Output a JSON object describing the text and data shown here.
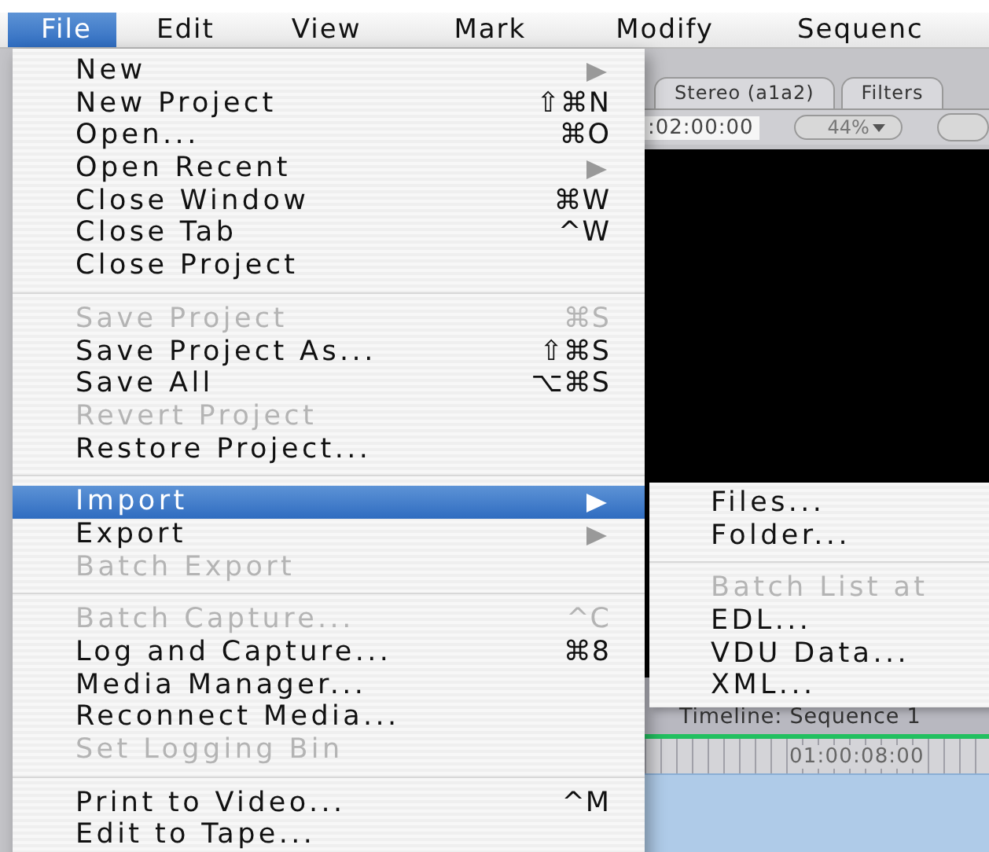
{
  "menubar": [
    {
      "label": "File",
      "selected": true
    },
    {
      "label": "Edit",
      "selected": false
    },
    {
      "label": "View",
      "selected": false
    },
    {
      "label": "Mark",
      "selected": false
    },
    {
      "label": "Modify",
      "selected": false
    },
    {
      "label": "Sequenc",
      "selected": false
    }
  ],
  "file_menu": {
    "items": [
      {
        "kind": "item",
        "label": "New",
        "submenu": true,
        "disabled": false,
        "selected": false
      },
      {
        "kind": "item",
        "label": "New Project",
        "shortcut": "⇧⌘N",
        "disabled": false,
        "selected": false
      },
      {
        "kind": "item",
        "label": "Open...",
        "shortcut": "⌘O",
        "disabled": false,
        "selected": false
      },
      {
        "kind": "item",
        "label": "Open Recent",
        "submenu": true,
        "disabled": false,
        "selected": false
      },
      {
        "kind": "item",
        "label": "Close Window",
        "shortcut": "⌘W",
        "disabled": false,
        "selected": false
      },
      {
        "kind": "item",
        "label": "Close Tab",
        "shortcut": "^W",
        "disabled": false,
        "selected": false
      },
      {
        "kind": "item",
        "label": "Close Project",
        "disabled": false,
        "selected": false
      },
      {
        "kind": "separator"
      },
      {
        "kind": "item",
        "label": "Save Project",
        "shortcut": "⌘S",
        "disabled": true,
        "selected": false
      },
      {
        "kind": "item",
        "label": "Save Project As...",
        "shortcut": "⇧⌘S",
        "disabled": false,
        "selected": false
      },
      {
        "kind": "item",
        "label": "Save All",
        "shortcut": "⌥⌘S",
        "disabled": false,
        "selected": false
      },
      {
        "kind": "item",
        "label": "Revert Project",
        "disabled": true,
        "selected": false
      },
      {
        "kind": "item",
        "label": "Restore Project...",
        "disabled": false,
        "selected": false
      },
      {
        "kind": "separator"
      },
      {
        "kind": "item",
        "label": "Import",
        "submenu": true,
        "disabled": false,
        "selected": true
      },
      {
        "kind": "item",
        "label": "Export",
        "submenu": true,
        "disabled": false,
        "selected": false
      },
      {
        "kind": "item",
        "label": "Batch Export",
        "disabled": true,
        "selected": false
      },
      {
        "kind": "separator"
      },
      {
        "kind": "item",
        "label": "Batch Capture...",
        "shortcut": "^C",
        "disabled": true,
        "selected": false
      },
      {
        "kind": "item",
        "label": "Log and Capture...",
        "shortcut": "⌘8",
        "disabled": false,
        "selected": false
      },
      {
        "kind": "item",
        "label": "Media Manager...",
        "disabled": false,
        "selected": false
      },
      {
        "kind": "item",
        "label": "Reconnect Media...",
        "disabled": false,
        "selected": false
      },
      {
        "kind": "item",
        "label": "Set Logging Bin",
        "disabled": true,
        "selected": false
      },
      {
        "kind": "separator"
      },
      {
        "kind": "item",
        "label": "Print to Video...",
        "shortcut": "^M",
        "disabled": false,
        "selected": false
      },
      {
        "kind": "item",
        "label": "Edit to Tape...",
        "disabled": false,
        "selected": false
      }
    ]
  },
  "import_submenu": {
    "items": [
      {
        "kind": "item",
        "label": "Files...",
        "disabled": false
      },
      {
        "kind": "item",
        "label": "Folder...",
        "disabled": false
      },
      {
        "kind": "separator"
      },
      {
        "kind": "item",
        "label": "Batch List at",
        "disabled": true
      },
      {
        "kind": "item",
        "label": "EDL...",
        "disabled": false
      },
      {
        "kind": "item",
        "label": "VDU Data...",
        "disabled": false
      },
      {
        "kind": "item",
        "label": "XML...",
        "disabled": false
      }
    ]
  },
  "viewer": {
    "tabs": [
      {
        "label": "Stereo (a1a2)"
      },
      {
        "label": "Filters"
      }
    ],
    "timecode": ":02:00:00",
    "zoom": "44%"
  },
  "timeline": {
    "title": "Timeline: Sequence 1",
    "ruler_time": "01:00:08:00"
  }
}
